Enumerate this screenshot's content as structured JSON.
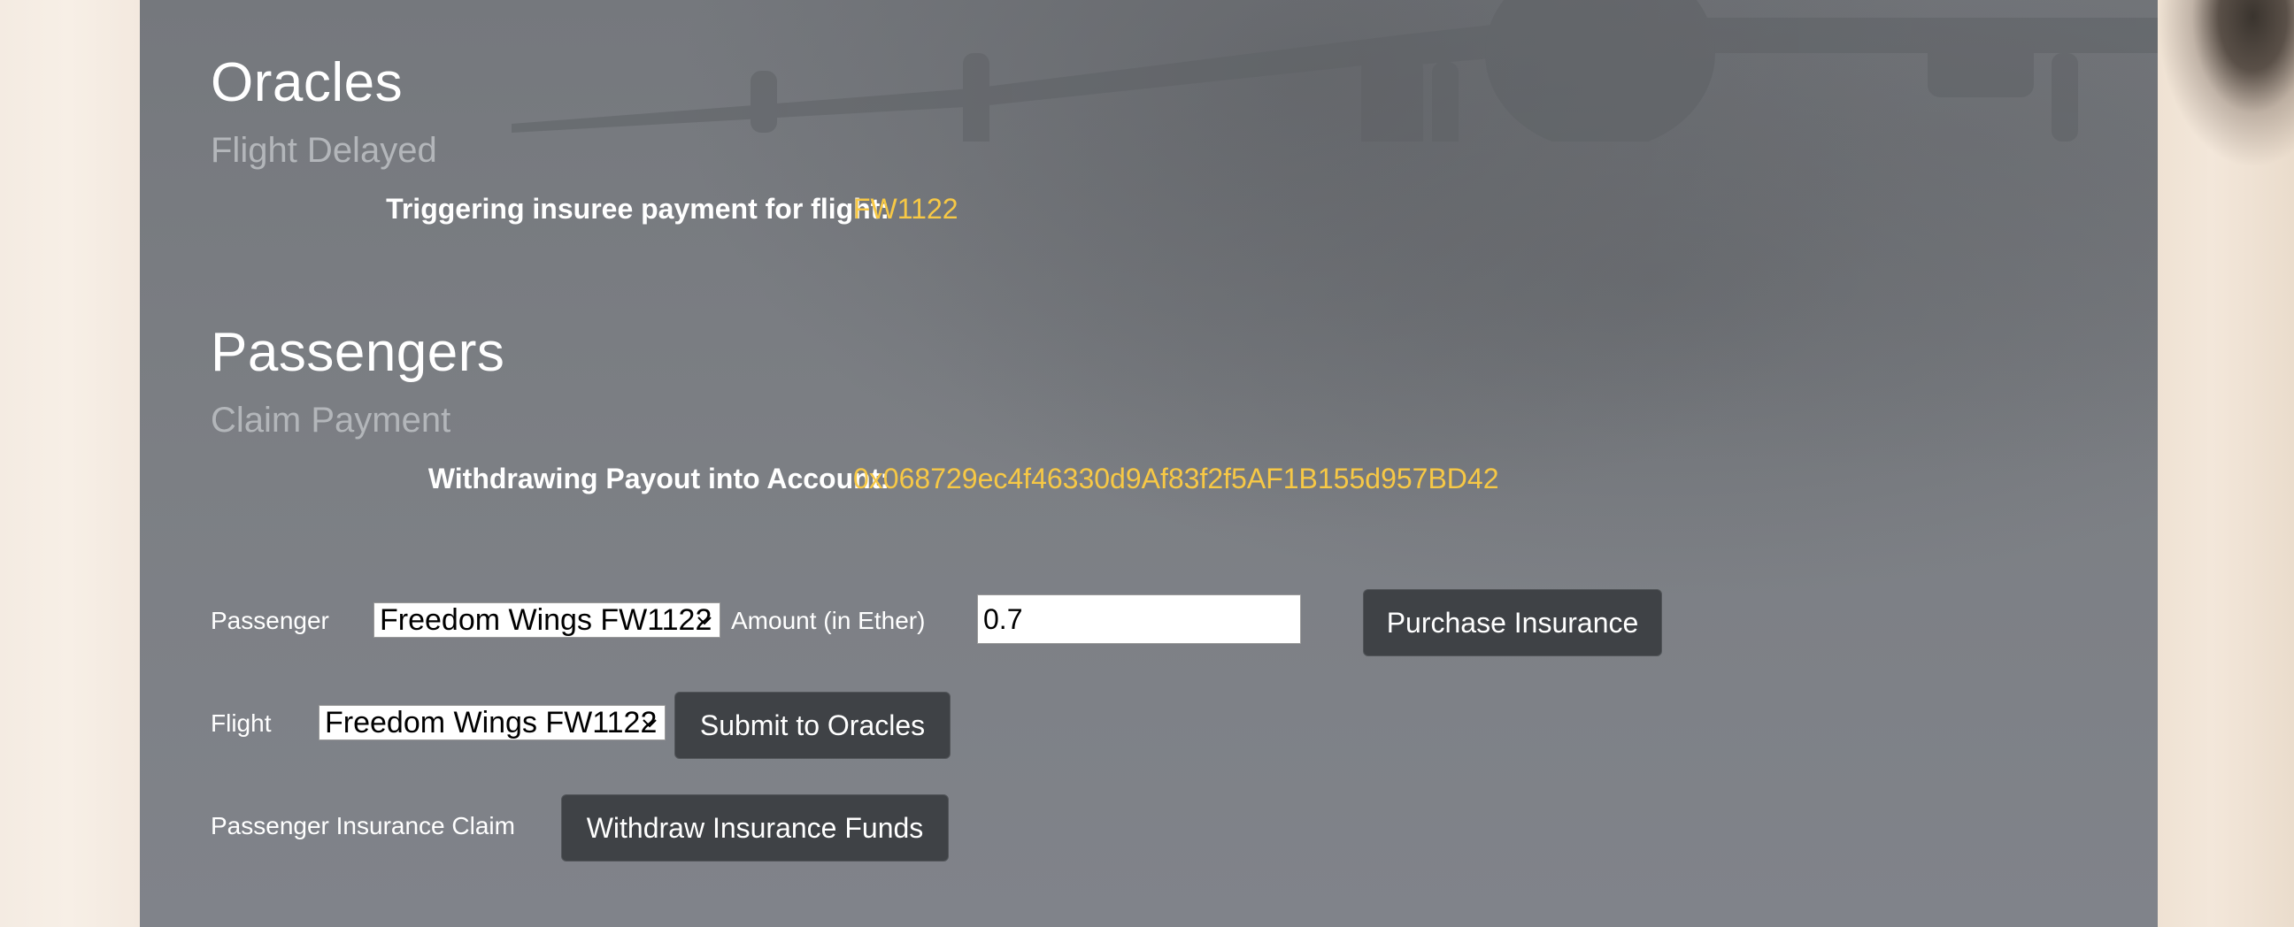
{
  "oracles": {
    "title": "Oracles",
    "subtitle": "Flight Delayed",
    "info_label": "Triggering insuree payment for flight:",
    "info_value": "FW1122"
  },
  "passengers": {
    "title": "Passengers",
    "subtitle": "Claim Payment",
    "info_label": "Withdrawing Payout into Account:",
    "info_value": "0x068729ec4f46330d9Af83f2f5AF1B155d957BD42"
  },
  "form": {
    "passenger_label": "Passenger",
    "passenger_select_value": "Freedom Wings FW1122",
    "amount_label": "Amount (in Ether)",
    "amount_value": "0.7",
    "purchase_button": "Purchase Insurance",
    "flight_label": "Flight",
    "flight_select_value": "Freedom Wings FW1122",
    "submit_button": "Submit to Oracles",
    "claim_label": "Passenger Insurance Claim",
    "withdraw_button": "Withdraw Insurance Funds"
  },
  "colors": {
    "accent": "#f7c845",
    "panel": "#7a7d82",
    "button": "#3f4246"
  },
  "icons": {
    "select_chevron": "chevron-down-icon"
  }
}
